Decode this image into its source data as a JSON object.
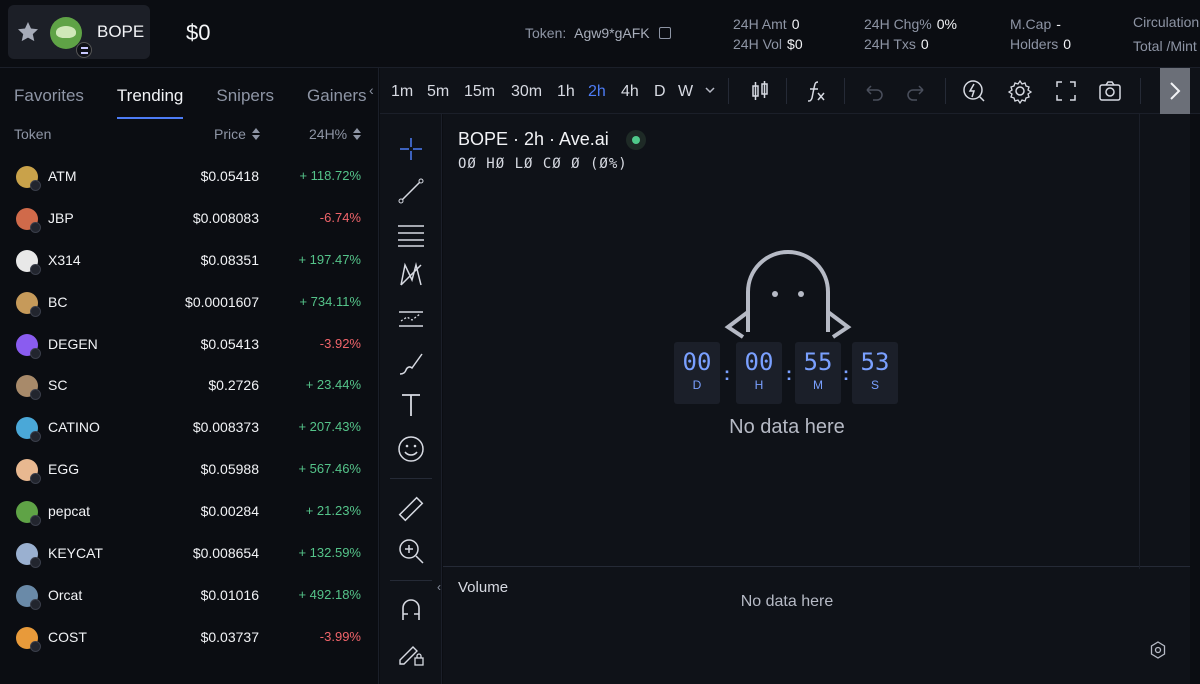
{
  "header": {
    "token_name": "BOPE",
    "price": "$0",
    "token_label": "Token:",
    "token_address": "Agw9*gAFK",
    "stats": [
      {
        "label": "24H Amt",
        "value": "0"
      },
      {
        "label": "24H Vol",
        "value": "$0"
      },
      {
        "label": "24H Chg%",
        "value": "0%"
      },
      {
        "label": "24H Txs",
        "value": "0"
      },
      {
        "label": "M.Cap",
        "value": "-"
      },
      {
        "label": "Holders",
        "value": "0"
      },
      {
        "label": "Circulation",
        "value": ""
      },
      {
        "label": "Total /Mint",
        "value": ""
      }
    ]
  },
  "left_panel": {
    "tabs": [
      "Favorites",
      "Trending",
      "Snipers",
      "Gainers"
    ],
    "active_tab": "Trending",
    "columns": {
      "token": "Token",
      "price": "Price",
      "change": "24H%"
    },
    "rows": [
      {
        "symbol": "ATM",
        "price": "$0.05418",
        "change": "+ 118.72%",
        "dir": "pos",
        "color": "#c9a24a"
      },
      {
        "symbol": "JBP",
        "price": "$0.008083",
        "change": "-6.74%",
        "dir": "neg",
        "color": "#d06a4a"
      },
      {
        "symbol": "X314",
        "price": "$0.08351",
        "change": "+ 197.47%",
        "dir": "pos",
        "color": "#e8e8e8"
      },
      {
        "symbol": "BC",
        "price": "$0.0001607",
        "change": "+ 734.11%",
        "dir": "pos",
        "color": "#c69a5a"
      },
      {
        "symbol": "DEGEN",
        "price": "$0.05413",
        "change": "-3.92%",
        "dir": "neg",
        "color": "#8a5cf0"
      },
      {
        "symbol": "SC",
        "price": "$0.2726",
        "change": "+ 23.44%",
        "dir": "pos",
        "color": "#a88a6a"
      },
      {
        "symbol": "CATINO",
        "price": "$0.008373",
        "change": "+ 207.43%",
        "dir": "pos",
        "color": "#4aa8d8"
      },
      {
        "symbol": "EGG",
        "price": "$0.05988",
        "change": "+ 567.46%",
        "dir": "pos",
        "color": "#e8b890"
      },
      {
        "symbol": "pepcat",
        "price": "$0.00284",
        "change": "+ 21.23%",
        "dir": "pos",
        "color": "#5fa346"
      },
      {
        "symbol": "KEYCAT",
        "price": "$0.008654",
        "change": "+ 132.59%",
        "dir": "pos",
        "color": "#9ab0d0"
      },
      {
        "symbol": "Orcat",
        "price": "$0.01016",
        "change": "+ 492.18%",
        "dir": "pos",
        "color": "#6a8aa8"
      },
      {
        "symbol": "COST",
        "price": "$0.03737",
        "change": "-3.99%",
        "dir": "neg",
        "color": "#e89a3a"
      }
    ]
  },
  "toolbar": {
    "timeframes": [
      "1m",
      "5m",
      "15m",
      "30m",
      "1h",
      "2h",
      "4h",
      "D",
      "W"
    ],
    "active_timeframe": "2h",
    "icons": [
      "candlestick-icon",
      "indicator-fx-icon",
      "undo-icon",
      "redo-icon",
      "flash-icon",
      "settings-icon",
      "fullscreen-icon",
      "camera-icon",
      "scroll-right-icon"
    ]
  },
  "chart": {
    "title": "BOPE · 2h · Ave.ai",
    "ohlc": "OØ HØ LØ CØ Ø (Ø%)",
    "countdown": [
      {
        "value": "00",
        "unit": "D"
      },
      {
        "value": "00",
        "unit": "H"
      },
      {
        "value": "55",
        "unit": "M"
      },
      {
        "value": "53",
        "unit": "S"
      }
    ],
    "no_data": "No data here",
    "volume_label": "Volume",
    "volume_no_data": "No data here"
  },
  "colors": {
    "accent": "#4d7cf5",
    "positive": "#55c48a",
    "negative": "#f0646a",
    "countdown": "#7aa0ff"
  }
}
